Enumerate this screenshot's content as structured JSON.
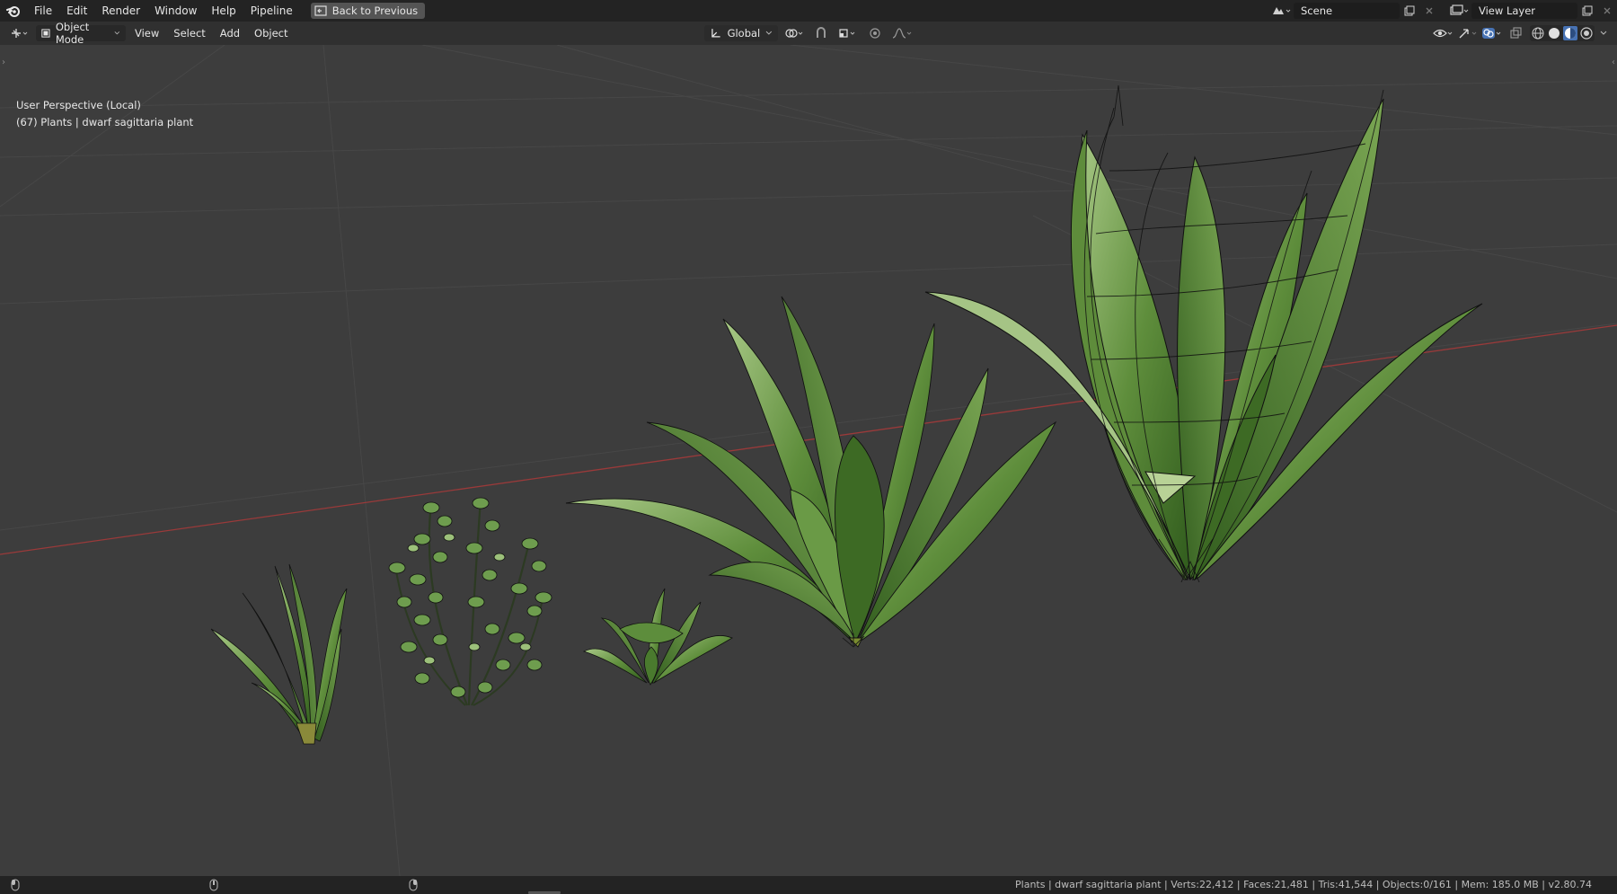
{
  "topbar": {
    "menus": [
      "File",
      "Edit",
      "Render",
      "Window",
      "Help",
      "Pipeline"
    ],
    "back_button": "Back to Previous",
    "scene_name": "Scene",
    "view_layer_name": "View Layer"
  },
  "viewport_header": {
    "mode": "Object Mode",
    "menus": [
      "View",
      "Select",
      "Add",
      "Object"
    ],
    "orientation": "Global"
  },
  "viewport": {
    "perspective_label": "User Perspective (Local)",
    "object_label": "(67) Plants | dwarf sagittaria plant"
  },
  "statusbar": {
    "text": "Plants | dwarf sagittaria plant | Verts:22,412 | Faces:21,481 | Tris:41,544 | Objects:0/161 | Mem: 185.0 MB | v2.80.74"
  },
  "colors": {
    "background": "#3d3d3d",
    "header": "#303030",
    "topbar": "#232323",
    "x_axis": "#9a3a3a",
    "leaf_dark": "#3f6e26",
    "leaf_light": "#9fc27b"
  }
}
